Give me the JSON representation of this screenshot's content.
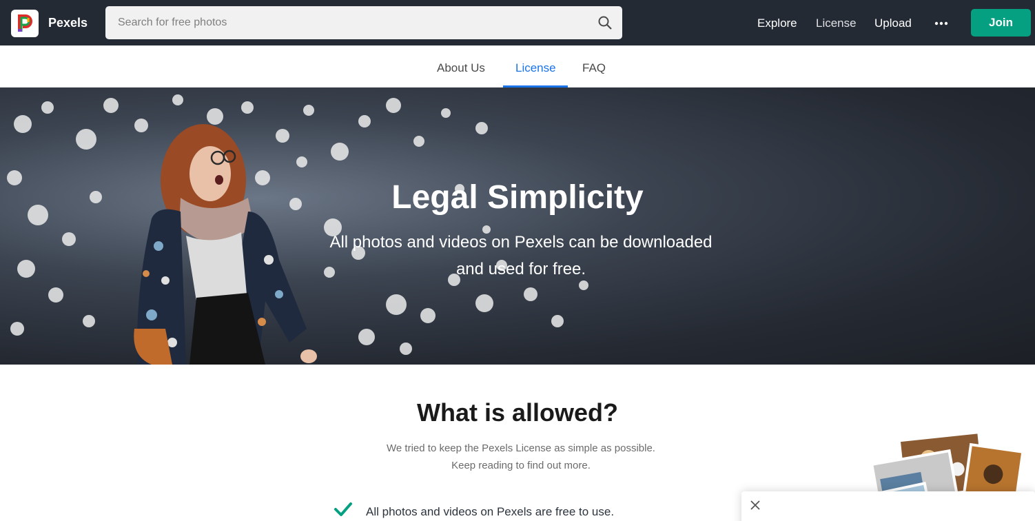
{
  "navbar": {
    "brand": "Pexels",
    "search_placeholder": "Search for free photos",
    "links": [
      "Explore",
      "License",
      "Upload"
    ],
    "more_icon": "more-dots-icon",
    "join_label": "Join"
  },
  "subnav": {
    "tabs": [
      "About Us",
      "License",
      "FAQ"
    ],
    "active": "License"
  },
  "hero": {
    "title": "Legal Simplicity",
    "subtitle_line1": "All photos and videos on Pexels can be downloaded",
    "subtitle_line2": "and used for free."
  },
  "allowed": {
    "title": "What is allowed?",
    "lead_line1": "We tried to keep the Pexels License as simple as possible.",
    "lead_line2": "Keep reading to find out more.",
    "items": [
      "All photos and videos on Pexels are free to use."
    ]
  },
  "colors": {
    "topbar": "#232a34",
    "accent": "#05a081",
    "active_tab": "#1a73e8"
  }
}
